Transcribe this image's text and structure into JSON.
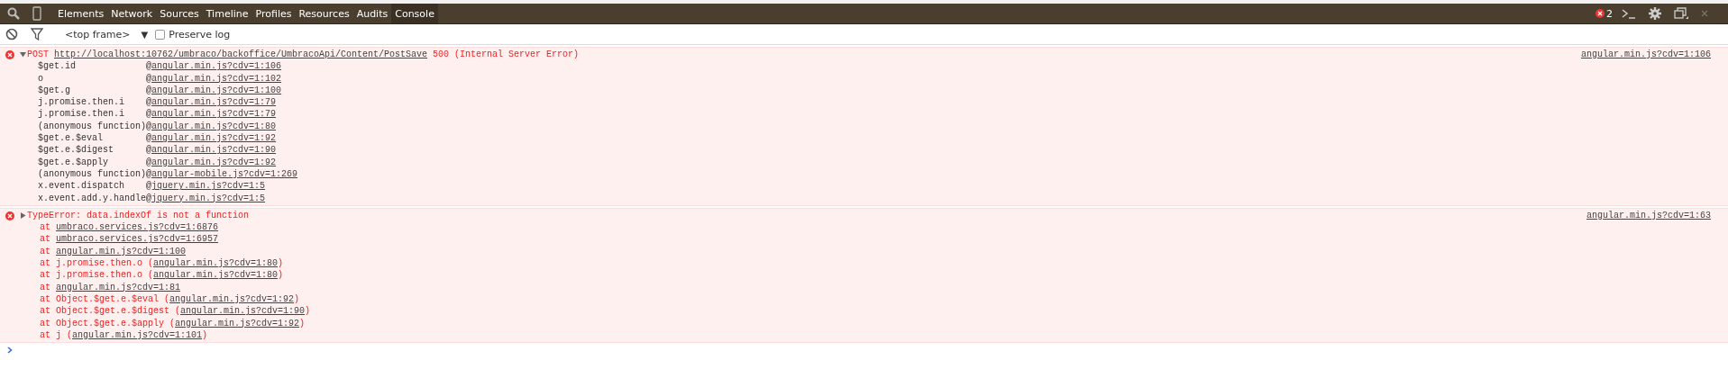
{
  "tabs": [
    {
      "label": "Elements",
      "selected": false
    },
    {
      "label": "Network",
      "selected": false
    },
    {
      "label": "Sources",
      "selected": false
    },
    {
      "label": "Timeline",
      "selected": false
    },
    {
      "label": "Profiles",
      "selected": false
    },
    {
      "label": "Resources",
      "selected": false
    },
    {
      "label": "Audits",
      "selected": false
    },
    {
      "label": "Console",
      "selected": true
    }
  ],
  "error_count": "2",
  "filter_bar": {
    "frame": "<top frame>",
    "dropdown": "▼",
    "preserve_log": {
      "label": "Preserve log",
      "checked": false
    }
  },
  "messages": [
    {
      "kind": "network",
      "expanded": true,
      "method": "POST",
      "url": "http://localhost:10762/umbraco/backoffice/UmbracoApi/Content/PostSave",
      "status": "500 (Internal Server Error)",
      "source": "angular.min.js?cdv=1:106",
      "stack": [
        {
          "function": "$get.id",
          "at": "@",
          "location": "angular.min.js?cdv=1:106"
        },
        {
          "function": "o",
          "at": "@",
          "location": "angular.min.js?cdv=1:102"
        },
        {
          "function": "$get.g",
          "at": "@",
          "location": "angular.min.js?cdv=1:100"
        },
        {
          "function": "j.promise.then.i",
          "at": "@",
          "location": "angular.min.js?cdv=1:79"
        },
        {
          "function": "j.promise.then.i",
          "at": "@",
          "location": "angular.min.js?cdv=1:79"
        },
        {
          "function": "(anonymous function)",
          "at": "@",
          "location": "angular.min.js?cdv=1:80"
        },
        {
          "function": "$get.e.$eval",
          "at": "@",
          "location": "angular.min.js?cdv=1:92"
        },
        {
          "function": "$get.e.$digest",
          "at": "@",
          "location": "angular.min.js?cdv=1:90"
        },
        {
          "function": "$get.e.$apply",
          "at": "@",
          "location": "angular.min.js?cdv=1:92"
        },
        {
          "function": "(anonymous function)",
          "at": "@",
          "location": "angular-mobile.js?cdv=1:269"
        },
        {
          "function": "x.event.dispatch",
          "at": "@",
          "location": "jquery.min.js?cdv=1:5"
        },
        {
          "function": "x.event.add.y.handle",
          "at": "@",
          "location": "jquery.min.js?cdv=1:5"
        }
      ]
    },
    {
      "kind": "exception",
      "expanded": false,
      "text": "TypeError: data.indexOf is not a function",
      "source": "angular.min.js?cdv=1:63",
      "stack": [
        {
          "at": "at",
          "location": "umbraco.services.js?cdv=1:6876"
        },
        {
          "at": "at",
          "location": "umbraco.services.js?cdv=1:6957"
        },
        {
          "at": "at",
          "location": "angular.min.js?cdv=1:100"
        },
        {
          "at": "at",
          "function": "j.promise.then.o",
          "open": "(",
          "location": "angular.min.js?cdv=1:80",
          "close": ")"
        },
        {
          "at": "at",
          "function": "j.promise.then.o",
          "open": "(",
          "location": "angular.min.js?cdv=1:80",
          "close": ")"
        },
        {
          "at": "at",
          "location": "angular.min.js?cdv=1:81"
        },
        {
          "at": "at",
          "function": "Object.$get.e.$eval",
          "open": "(",
          "location": "angular.min.js?cdv=1:92",
          "close": ")"
        },
        {
          "at": "at",
          "function": "Object.$get.e.$digest",
          "open": "(",
          "location": "angular.min.js?cdv=1:90",
          "close": ")"
        },
        {
          "at": "at",
          "function": "Object.$get.e.$apply",
          "open": "(",
          "location": "angular.min.js?cdv=1:92",
          "close": ")"
        },
        {
          "at": "at",
          "function": "j",
          "open": "(",
          "location": "angular.min.js?cdv=1:101",
          "close": ")"
        }
      ]
    }
  ]
}
